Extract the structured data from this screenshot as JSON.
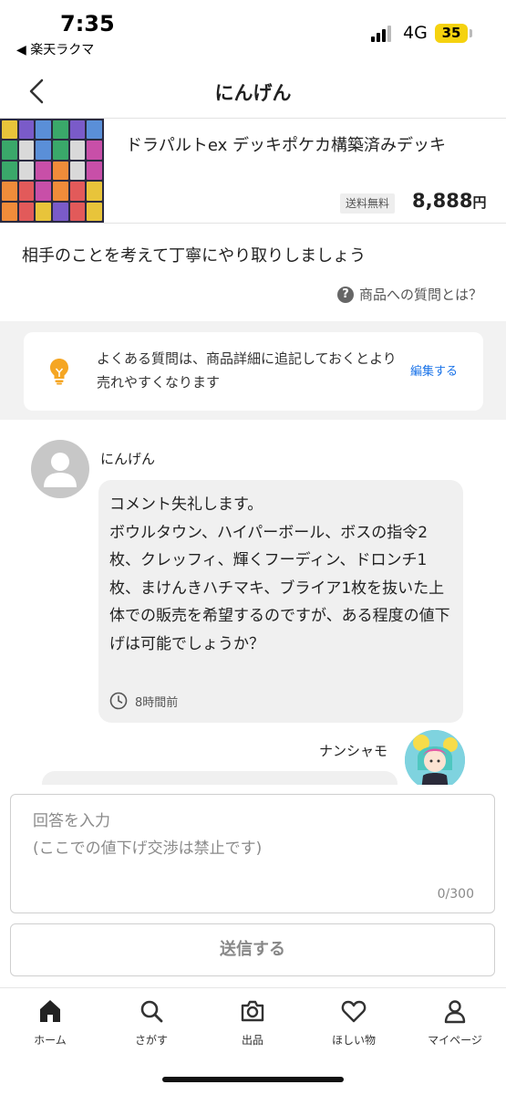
{
  "status_bar": {
    "time": "7:35",
    "back_app": "◀ 楽天ラクマ",
    "network": "4G",
    "battery": "35"
  },
  "header": {
    "title": "にんげん"
  },
  "product": {
    "name": "ドラパルトex デッキポケカ構築済みデッキ",
    "shipping_badge": "送料無料",
    "price": "8,888",
    "price_unit": "円"
  },
  "notice": {
    "text": "相手のことを考えて丁寧にやり取りしましょう",
    "help_link": "商品への質問とは？"
  },
  "tip": {
    "text": "よくある質問は、商品詳細に追記しておくとより売れやすくなります",
    "edit_label": "編集する"
  },
  "conversation": {
    "question": {
      "user": "にんげん",
      "text": "コメント失礼します。\nボウルタウン、ハイパーボール、ボスの指令2枚、クレッフィ、輝くフーディン、ドロンチ1枚、まけんきハチマキ、ブライア1枚を抜いた上体での販売を希望するのですが、ある程度の値下げは可能でしょうか？",
      "time": "8時間前"
    },
    "answer": {
      "user": "ナンシャモ"
    }
  },
  "answer_input": {
    "placeholder": "回答を入力\n(ここでの値下げ交渉は禁止です)",
    "counter": "0/300"
  },
  "send_button": "送信する",
  "tabbar": {
    "items": [
      {
        "label": "ホーム",
        "icon": "home-icon"
      },
      {
        "label": "さがす",
        "icon": "search-icon"
      },
      {
        "label": "出品",
        "icon": "camera-icon"
      },
      {
        "label": "ほしい物",
        "icon": "heart-icon"
      },
      {
        "label": "マイページ",
        "icon": "person-icon"
      }
    ]
  },
  "colors": {
    "link": "#1a73e8",
    "bulb": "#f5a623",
    "band": "#f2f2f2",
    "bubble": "#f0f0f0"
  }
}
